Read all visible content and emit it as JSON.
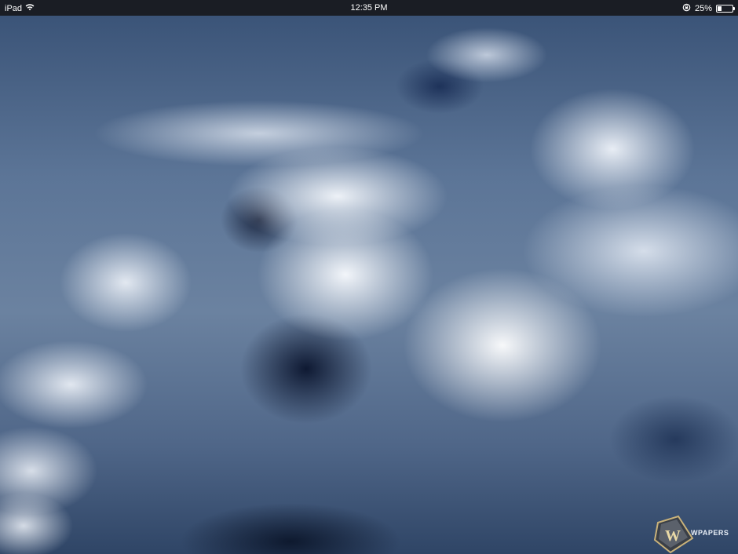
{
  "status_bar": {
    "device_label": "iPad",
    "time": "12:35 PM",
    "battery_percent_label": "25%",
    "battery_level": 0.25,
    "wifi_icon": "wifi-icon",
    "orientation_lock_icon": "orientation-lock-icon",
    "battery_icon": "battery-icon"
  },
  "wallpaper": {
    "logo_text": "WPAPERS",
    "logo_letter": "W",
    "accent_colors": [
      "#3b5478",
      "#ffffff",
      "#0a142d"
    ]
  }
}
